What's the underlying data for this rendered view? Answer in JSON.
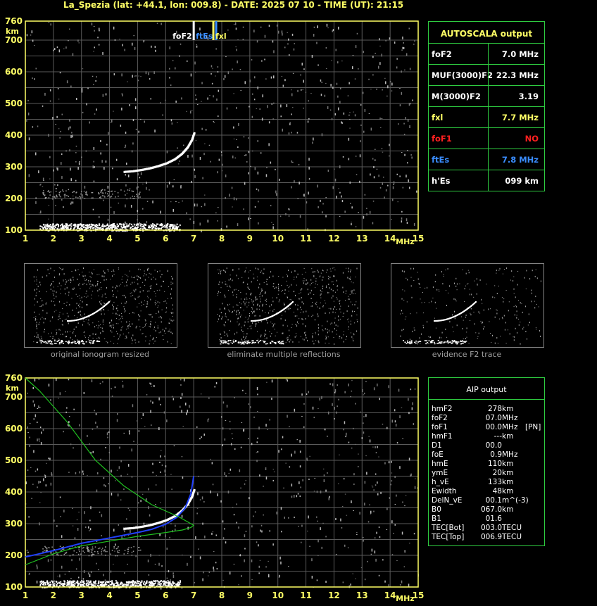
{
  "header": "La_Spezia (lat: +44.1, lon: 009.8) - DATE: 2025 07 10 - TIME (UT): 21:15",
  "axes": {
    "x_ticks": [
      "1",
      "2",
      "3",
      "4",
      "5",
      "6",
      "7",
      "8",
      "9",
      "10",
      "11",
      "12",
      "13",
      "14",
      "15"
    ],
    "x_unit": "MHz",
    "y_ticks": [
      "100",
      "200",
      "300",
      "400",
      "500",
      "600",
      "700",
      "760"
    ],
    "y_unit": "km",
    "xlim": [
      1,
      15
    ],
    "ylim": [
      100,
      760
    ]
  },
  "markers": {
    "foF2": "foF2",
    "ftEs": "ftEs",
    "fxl": "fxl"
  },
  "autoscala": {
    "title": "AUTOSCALA output",
    "rows": [
      {
        "label": "foF2",
        "value": "7.0 MHz",
        "label_color": "#ffffff",
        "value_color": "#ffffff"
      },
      {
        "label": "MUF(3000)F2",
        "value": "22.3 MHz",
        "label_color": "#ffffff",
        "value_color": "#ffffff"
      },
      {
        "label": "M(3000)F2",
        "value": "3.19",
        "label_color": "#ffffff",
        "value_color": "#ffffff"
      },
      {
        "label": "fxl",
        "value": "7.7 MHz",
        "label_color": "#ffff66",
        "value_color": "#ffff66"
      },
      {
        "label": "foF1",
        "value": "NO",
        "label_color": "#ff2020",
        "value_color": "#ff2020"
      },
      {
        "label": "ftEs",
        "value": "7.8 MHz",
        "label_color": "#3a8dff",
        "value_color": "#3a8dff"
      },
      {
        "label": "h'Es",
        "value": "099     km",
        "label_color": "#ffffff",
        "value_color": "#ffffff"
      }
    ]
  },
  "thumb_captions": [
    "original ionogram resized",
    "eliminate multiple reflections",
    "evidence F2 trace"
  ],
  "aip": {
    "title": "AIP output",
    "rows": [
      {
        "name": "hmF2",
        "value": "278",
        "unit": "km",
        "extra": ""
      },
      {
        "name": "foF2",
        "value": "07.0",
        "unit": "MHz",
        "extra": ""
      },
      {
        "name": "foF1",
        "value": "00.0",
        "unit": "MHz",
        "extra": "[PN]"
      },
      {
        "name": "hmF1",
        "value": "---",
        "unit": "km",
        "extra": ""
      },
      {
        "name": "D1",
        "value": "00.0",
        "unit": "",
        "extra": ""
      },
      {
        "name": "foE",
        "value": "0.9",
        "unit": "MHz",
        "extra": ""
      },
      {
        "name": "hmE",
        "value": "110",
        "unit": "km",
        "extra": ""
      },
      {
        "name": "ymE",
        "value": "20",
        "unit": "km",
        "extra": ""
      },
      {
        "name": "h_vE",
        "value": "133",
        "unit": "km",
        "extra": ""
      },
      {
        "name": "Ewidth",
        "value": "48",
        "unit": "km",
        "extra": ""
      },
      {
        "name": "DelN_vE",
        "value": "00.1",
        "unit": "m^(-3)",
        "extra": ""
      },
      {
        "name": "B0",
        "value": "067.0",
        "unit": "km",
        "extra": ""
      },
      {
        "name": "B1",
        "value": "01.6",
        "unit": "",
        "extra": ""
      },
      {
        "name": "TEC[Bot]",
        "value": "003.0",
        "unit": "TECU",
        "extra": ""
      },
      {
        "name": "TEC[Top]",
        "value": "006.9",
        "unit": "TECU",
        "extra": ""
      }
    ]
  },
  "chart_data": [
    {
      "type": "scatter",
      "title": "",
      "xlabel": "MHz",
      "ylabel": "km",
      "xlim": [
        1,
        15
      ],
      "ylim": [
        100,
        760
      ],
      "grid": true,
      "series": [
        {
          "name": "",
          "color": "#ffffff",
          "x": [
            4.5,
            5.0,
            5.5,
            6.0,
            6.4,
            6.7,
            6.9,
            7.0
          ],
          "y": [
            285,
            290,
            298,
            312,
            330,
            355,
            390,
            410
          ]
        },
        {
          "name": "",
          "color": "#ffffff",
          "x": [
            1.5,
            2.5,
            3.5,
            4.5,
            5.5,
            6.5
          ],
          "y": [
            110,
            115,
            112,
            110,
            108,
            108
          ]
        }
      ],
      "vertical_markers": [
        {
          "label": "foF2",
          "x": 7.0,
          "color": "#ffffff"
        },
        {
          "label": "ftEs",
          "x": 7.8,
          "color": "#3a8dff"
        },
        {
          "label": "fxl",
          "x": 7.7,
          "color": "#ffff66"
        }
      ]
    },
    {
      "type": "line",
      "title": "",
      "xlabel": "MHz",
      "ylabel": "km",
      "xlim": [
        1,
        15
      ],
      "ylim": [
        100,
        760
      ],
      "grid": true,
      "series": [
        {
          "name": "",
          "color": "#2040ff",
          "x": [
            1.0,
            2.0,
            3.0,
            4.0,
            5.0,
            5.5,
            6.0,
            6.4,
            6.7,
            6.9,
            7.0
          ],
          "y": [
            195,
            215,
            238,
            255,
            272,
            282,
            298,
            320,
            350,
            395,
            450
          ]
        },
        {
          "name": "",
          "color": "#20c020",
          "x": [
            1.0,
            2.0,
            3.0,
            4.0,
            5.0,
            6.0,
            6.6,
            6.9,
            7.0,
            6.5,
            5.5,
            4.5,
            3.5,
            2.5,
            1.5,
            1.0
          ],
          "y": [
            170,
            205,
            230,
            245,
            260,
            272,
            280,
            288,
            295,
            320,
            360,
            420,
            500,
            620,
            720,
            760
          ]
        }
      ]
    }
  ]
}
